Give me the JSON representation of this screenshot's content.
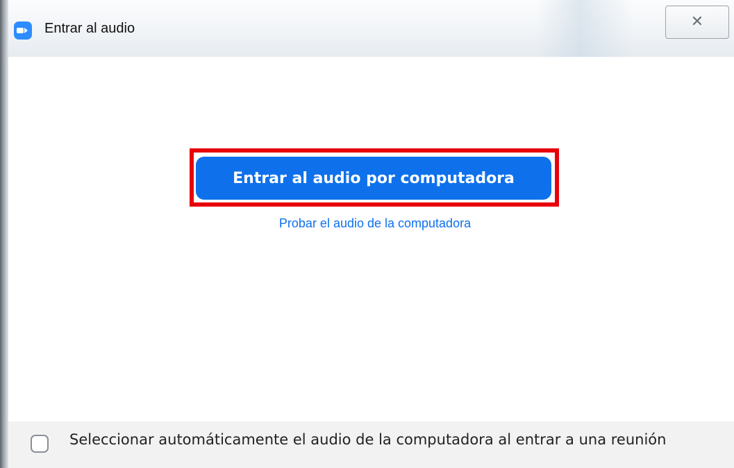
{
  "window": {
    "title": "Entrar al audio",
    "app_icon": "zoom-camera-icon",
    "close_icon": "close-icon",
    "close_glyph": "✕"
  },
  "main": {
    "join_button_label": "Entrar al audio por computadora",
    "test_link_label": "Probar el audio de la computadora"
  },
  "footer": {
    "checkbox_checked": false,
    "checkbox_label": "Seleccionar automáticamente el audio de la computadora al entrar a una reunión"
  },
  "colors": {
    "accent": "#0e71eb",
    "highlight": "#e8000b",
    "zoom_icon": "#2d8cff"
  }
}
